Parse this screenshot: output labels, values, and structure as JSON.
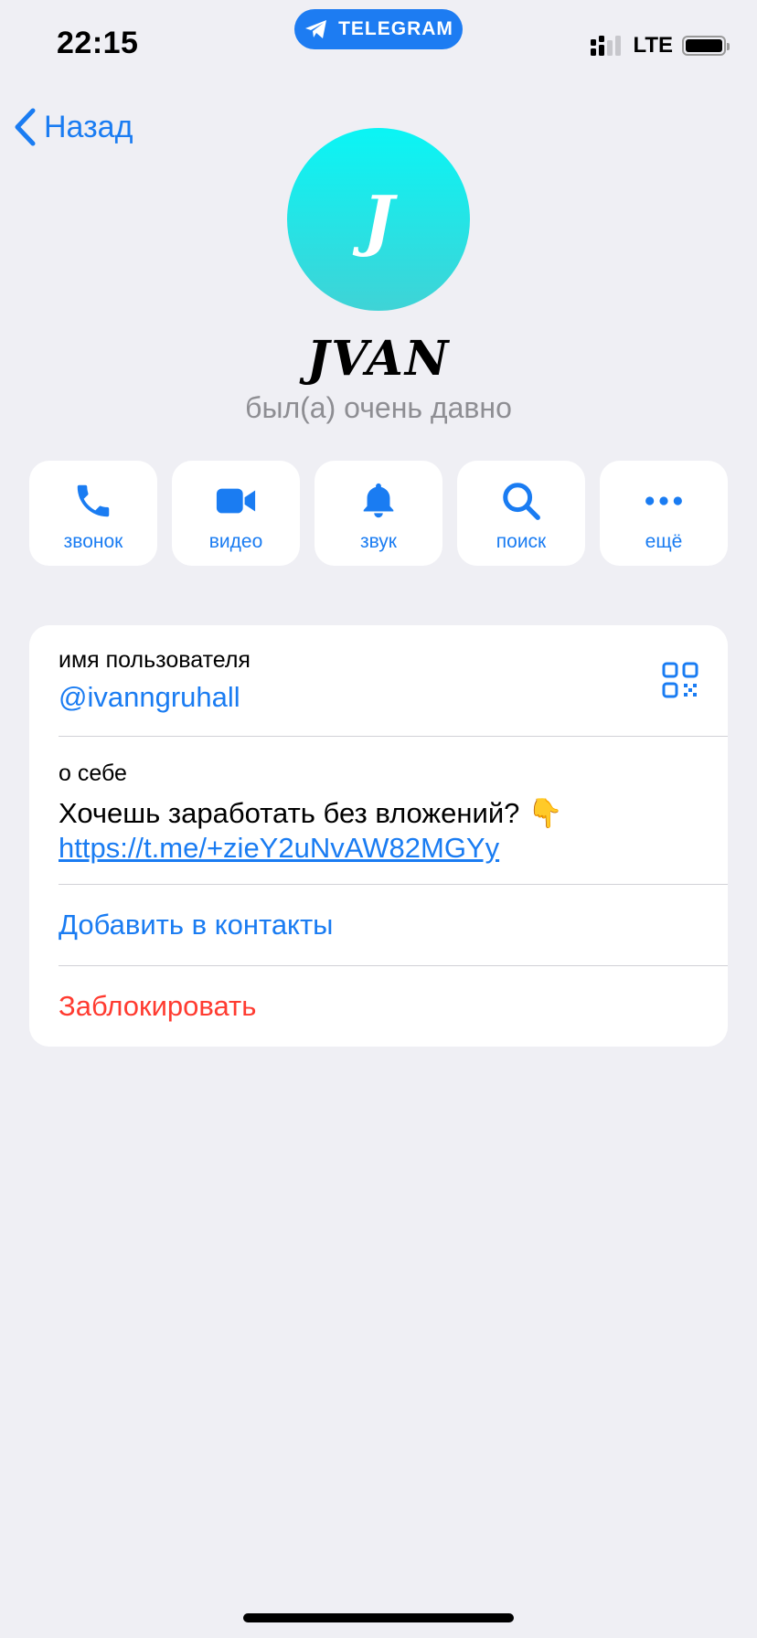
{
  "status_bar": {
    "time": "22:15",
    "app_pill": "TELEGRAM",
    "network": "LTE"
  },
  "nav": {
    "back_label": "Назад"
  },
  "profile": {
    "avatar_letter": "J",
    "avatar_gradient": [
      "#0af5f5",
      "#3fd3d6"
    ],
    "name": "JVAN",
    "last_seen": "был(а) очень давно"
  },
  "actions": [
    {
      "icon": "phone-icon",
      "label": "звонок"
    },
    {
      "icon": "video-icon",
      "label": "видео"
    },
    {
      "icon": "bell-icon",
      "label": "звук"
    },
    {
      "icon": "search-icon",
      "label": "поиск"
    },
    {
      "icon": "more-icon",
      "label": "ещё"
    }
  ],
  "info": {
    "username_label": "имя пользователя",
    "username_value": "@ivanngruhall",
    "about_label": "о себе",
    "about_text": "Хочешь заработать без вложений? 👇",
    "about_link": "https://t.me/+zieY2uNvAW82MGYy",
    "add_contact": "Добавить в контакты",
    "block": "Заблокировать"
  },
  "colors": {
    "accent": "#1a7cf2",
    "danger": "#ff3b30",
    "background": "#efeff4"
  }
}
